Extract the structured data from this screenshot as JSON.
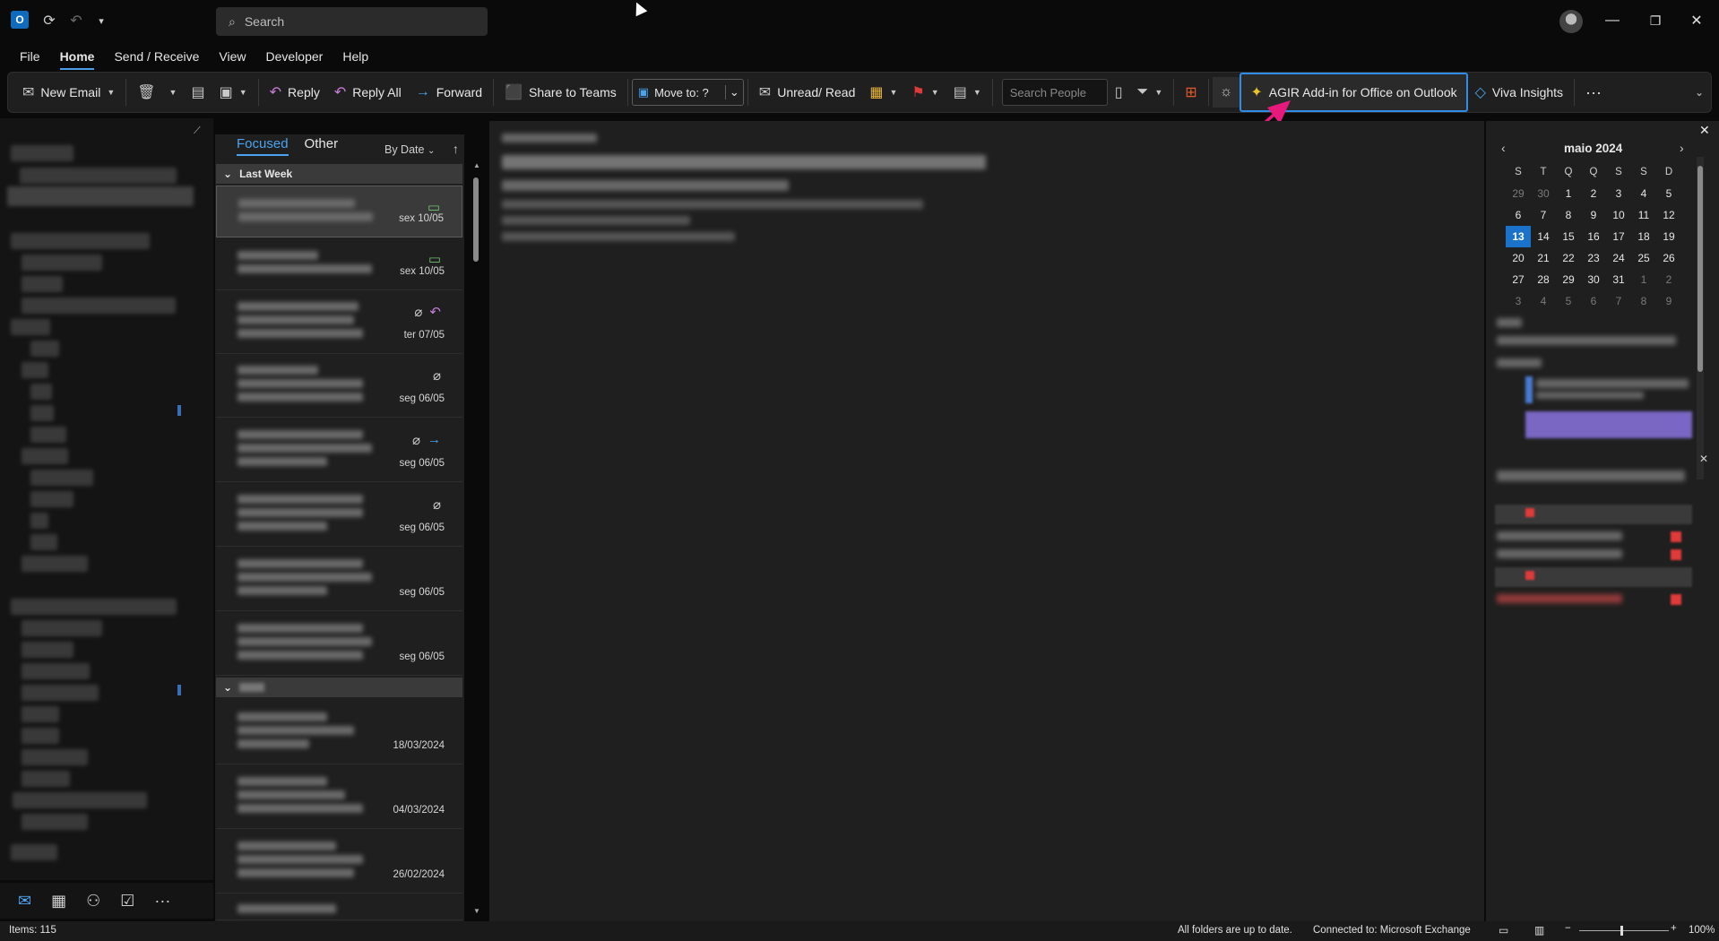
{
  "titlebar": {
    "search_placeholder": "Search",
    "minimize_icon": "minimize-icon",
    "maximize_icon": "restore-icon",
    "close_icon": "close-icon"
  },
  "menu": {
    "tabs": [
      "File",
      "Home",
      "Send / Receive",
      "View",
      "Developer",
      "Help"
    ],
    "active": "Home"
  },
  "ribbon": {
    "new_email": "New Email",
    "reply": "Reply",
    "reply_all": "Reply All",
    "forward": "Forward",
    "share_teams": "Share to Teams",
    "move_to": "Move to: ?",
    "unread_read": "Unread/ Read",
    "search_people": "Search People",
    "agir": "AGIR Add-in for Office on Outlook",
    "viva": "Viva Insights",
    "more": "···"
  },
  "message_list": {
    "tab_focused": "Focused",
    "tab_other": "Other",
    "sort": "By Date",
    "group_last_week": "Last Week",
    "dates": [
      "sex 10/05",
      "sex 10/05",
      "ter 07/05",
      "seg 06/05",
      "seg 06/05",
      "seg 06/05",
      "seg 06/05",
      "seg 06/05",
      "18/03/2024",
      "04/03/2024",
      "26/02/2024"
    ]
  },
  "calendar": {
    "title": "maio 2024",
    "weekdays": [
      "S",
      "T",
      "Q",
      "Q",
      "S",
      "S",
      "D"
    ],
    "weeks": [
      [
        "29",
        "30",
        "1",
        "2",
        "3",
        "4",
        "5"
      ],
      [
        "6",
        "7",
        "8",
        "9",
        "10",
        "11",
        "12"
      ],
      [
        "13",
        "14",
        "15",
        "16",
        "17",
        "18",
        "19"
      ],
      [
        "20",
        "21",
        "22",
        "23",
        "24",
        "25",
        "26"
      ],
      [
        "27",
        "28",
        "29",
        "30",
        "31",
        "1",
        "2"
      ],
      [
        "3",
        "4",
        "5",
        "6",
        "7",
        "8",
        "9"
      ]
    ],
    "today": "13"
  },
  "status": {
    "items": "Items: 115",
    "sync": "All folders are up to date.",
    "connection": "Connected to: Microsoft Exchange",
    "zoom": "100%"
  },
  "colors": {
    "accent": "#4aa3f0",
    "agir_border": "#2f8ce8",
    "annotation_arrow": "#e8197d",
    "today": "#1a73c8"
  }
}
